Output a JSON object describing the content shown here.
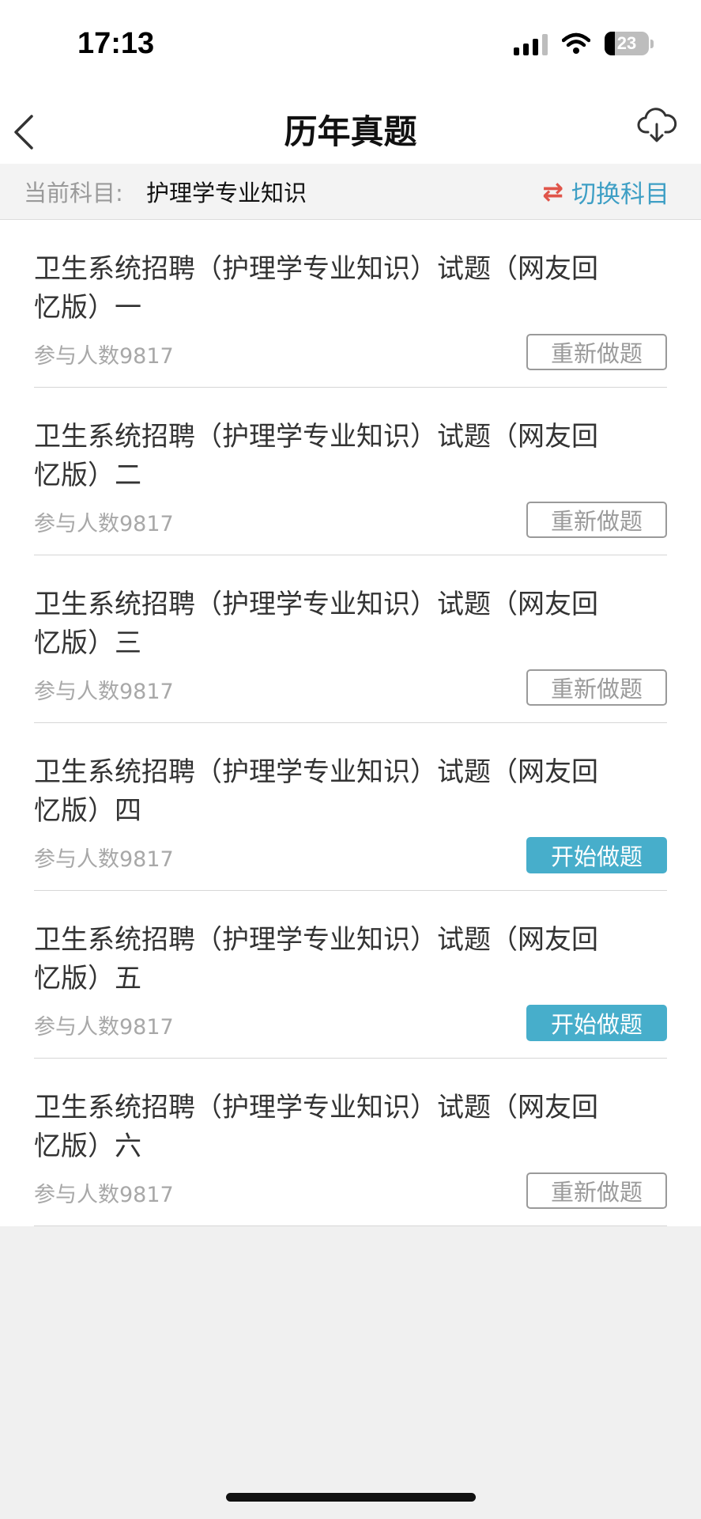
{
  "status": {
    "time": "17:13",
    "battery": "23"
  },
  "nav": {
    "title": "历年真题"
  },
  "subject": {
    "label": "当前科目:",
    "name": "护理学专业知识",
    "switch_icon": "⇄",
    "switch_label": "切换科目"
  },
  "items": [
    {
      "title": "卫生系统招聘（护理学专业知识）试题（网友回忆版）一",
      "count": "参与人数9817",
      "button": "重新做题",
      "state": "redo"
    },
    {
      "title": "卫生系统招聘（护理学专业知识）试题（网友回忆版）二",
      "count": "参与人数9817",
      "button": "重新做题",
      "state": "redo"
    },
    {
      "title": "卫生系统招聘（护理学专业知识）试题（网友回忆版）三",
      "count": "参与人数9817",
      "button": "重新做题",
      "state": "redo"
    },
    {
      "title": "卫生系统招聘（护理学专业知识）试题（网友回忆版）四",
      "count": "参与人数9817",
      "button": "开始做题",
      "state": "start"
    },
    {
      "title": "卫生系统招聘（护理学专业知识）试题（网友回忆版）五",
      "count": "参与人数9817",
      "button": "开始做题",
      "state": "start"
    },
    {
      "title": "卫生系统招聘（护理学专业知识）试题（网友回忆版）六",
      "count": "参与人数9817",
      "button": "重新做题",
      "state": "redo"
    }
  ],
  "colors": {
    "accent": "#47aecb",
    "switch_icon": "#e0554a",
    "switch_text": "#3e9fc5"
  }
}
